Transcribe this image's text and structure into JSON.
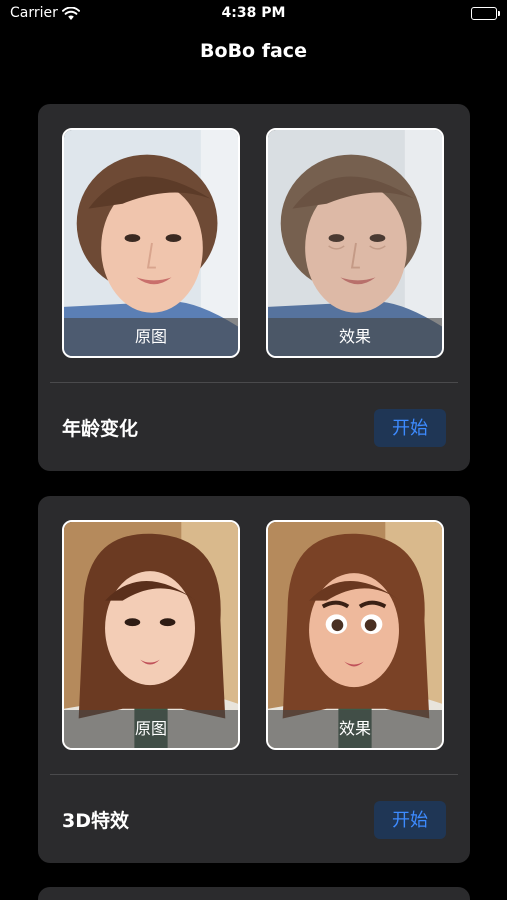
{
  "status_bar": {
    "carrier": "Carrier",
    "time": "4:38 PM"
  },
  "nav": {
    "title": "BoBo face"
  },
  "cards": [
    {
      "original_label": "原图",
      "effect_label": "效果",
      "title": "年龄变化",
      "button": "开始"
    },
    {
      "original_label": "原图",
      "effect_label": "效果",
      "title": "3D特效",
      "button": "开始"
    }
  ],
  "icons": {
    "wifi": "wifi-icon",
    "battery": "battery-icon"
  }
}
